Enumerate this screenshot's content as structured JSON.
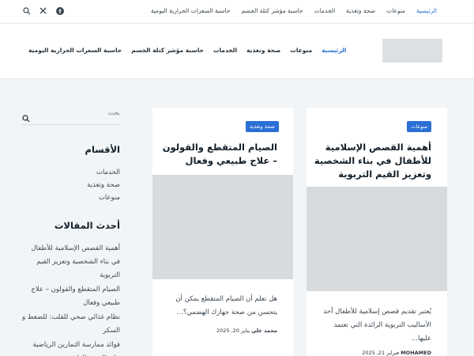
{
  "topbar": {
    "nav": [
      {
        "label": "الرئيسية",
        "active": true
      },
      {
        "label": "منوعات",
        "active": false
      },
      {
        "label": "صحة وتغذية",
        "active": false
      },
      {
        "label": "الخدمات",
        "active": false
      },
      {
        "label": "حاسبة مؤشر كتلة الجسم",
        "active": false
      },
      {
        "label": "حاسبة السعرات الحرارية اليومية",
        "active": false
      }
    ],
    "icons": [
      "search-icon",
      "x-icon",
      "facebook-icon"
    ]
  },
  "header": {
    "nav": [
      {
        "label": "الرئيسية",
        "active": true
      },
      {
        "label": "منوعات",
        "active": false
      },
      {
        "label": "صحة وتغذية",
        "active": false
      },
      {
        "label": "الخدمات",
        "active": false
      },
      {
        "label": "حاسبة مؤشر كتلة الجسم",
        "active": false
      },
      {
        "label": "حاسبة السعرات الحرارية اليومية",
        "active": false
      }
    ]
  },
  "posts": [
    {
      "badge": "منوعات",
      "title": "أهمية القصص الإسلامية للأطفال في بناء الشخصية وتعزيز القيم التربوية",
      "excerpt": "يُعتبر تقديم قصص إسلامية للأطفال أحد الأساليب التربوية الرائدة التي تعتمد عليها…",
      "author": "MOHAMED",
      "date": "فبراير 21, 2025"
    },
    {
      "badge": "صحة وتغذية",
      "title": "الصيام المتقطع والقولون – علاج طبيعي وفعال",
      "excerpt": "هل تعلم أن الصيام المتقطع يمكن أن يتحسن من صحة جهازك الهضمي؟…",
      "author": "محمد علي",
      "date": "يناير 20, 2025"
    }
  ],
  "sidebar": {
    "search_placeholder": "بحث",
    "categories_title": "الأقسام",
    "categories": [
      "الخدمات",
      "صحة وتغذية",
      "منوعات"
    ],
    "recent_title": "أحدث المقالات",
    "recent": [
      "أهمية القصص الإسلامية للأطفال في بناء الشخصية وتعزيز القيم التربوية",
      "الصيام المتقطع والقولون – علاج طبيعي وفعال",
      "نظام غذائي صحي للقلب: للضغط و السكر",
      "فوائد ممارسة التمارين الرياضية على الصحة العامة"
    ]
  },
  "colors": {
    "accent": "#2b6fd6",
    "background": "#f2f5f7"
  }
}
